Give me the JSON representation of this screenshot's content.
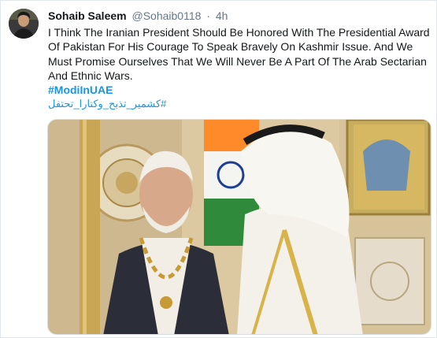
{
  "tweet": {
    "display_name": "Sohaib Saleem",
    "handle": "@Sohaib0118",
    "separator": "·",
    "time": "4h",
    "text": "I Think The Iranian President Should Be Honored With The Presidential Award Of Pakistan For His Courage To Speak Bravely On Kashmir Issue.  And We Must Promise Ourselves That We Will Never Be A Part Of The Arab Sectarian And Ethnic Wars.",
    "hashtags": [
      "#ModiInUAE",
      "#كشمير_تذبح_وكتارا_تحتفل"
    ]
  },
  "colors": {
    "link": "#1b95e0",
    "text": "#14171a",
    "muted": "#657786"
  },
  "icons": {
    "avatar": "user-avatar-photo"
  }
}
